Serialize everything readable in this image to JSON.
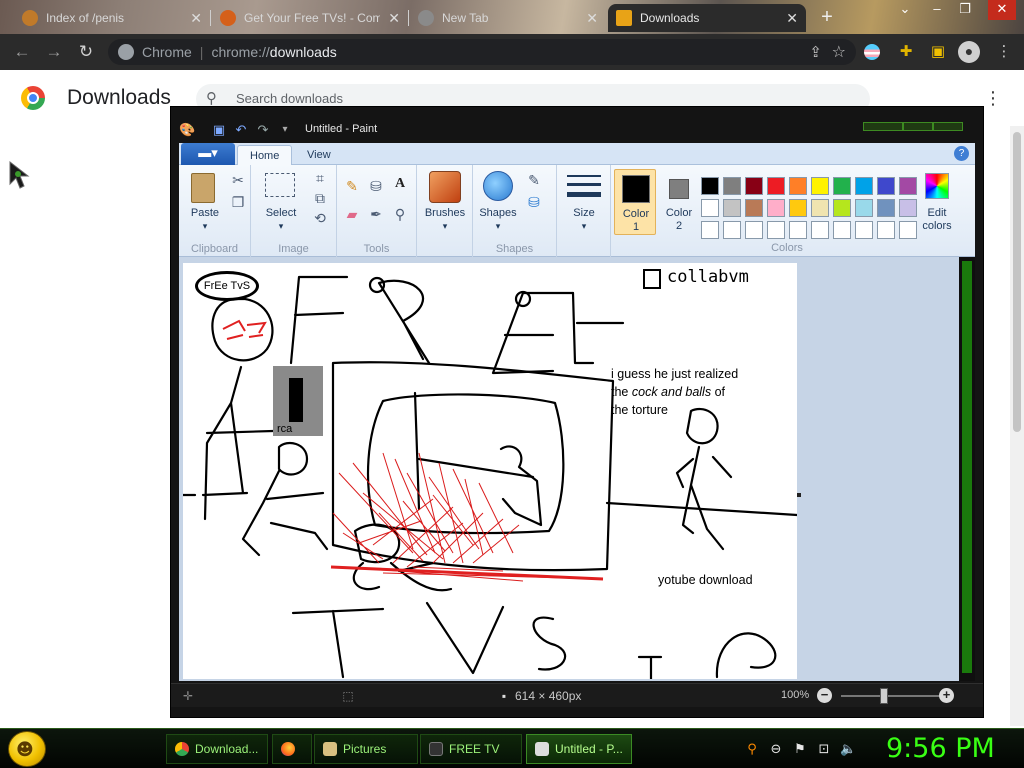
{
  "browser": {
    "tabs": [
      {
        "title": "Index of /penis"
      },
      {
        "title": "Get Your Free TVs! - Com"
      },
      {
        "title": "New Tab"
      },
      {
        "title": "Downloads"
      }
    ],
    "omnibox": {
      "site": "Chrome",
      "url_prefix": "chrome://",
      "url_path": "downloads"
    }
  },
  "downloads_page": {
    "title": "Downloads",
    "search_placeholder": "Search downloads"
  },
  "paint": {
    "window_title": "Untitled - Paint",
    "ribbon_tabs": [
      "Home",
      "View"
    ],
    "groups": {
      "clipboard": {
        "label": "Clipboard",
        "paste": "Paste"
      },
      "image": {
        "label": "Image",
        "select": "Select"
      },
      "tools": {
        "label": "Tools"
      },
      "brushes": "Brushes",
      "shapes": {
        "label": "Shapes",
        "shapes_btn": "Shapes"
      },
      "size": "Size",
      "color1": {
        "line1": "Color",
        "line2": "1"
      },
      "color2": {
        "line1": "Color",
        "line2": "2"
      },
      "colors": {
        "label": "Colors",
        "edit_line1": "Edit",
        "edit_line2": "colors"
      }
    },
    "palette": [
      "#000000",
      "#7f7f7f",
      "#880015",
      "#ed1c24",
      "#ff7f27",
      "#fff200",
      "#22b14c",
      "#00a2e8",
      "#3f48cc",
      "#a349a4",
      "#ffffff",
      "#c3c3c3",
      "#b97a57",
      "#ffaec9",
      "#ffc90e",
      "#efe4b0",
      "#b5e61d",
      "#99d9ea",
      "#7092be",
      "#c8bfe7",
      "#ffffff",
      "#ffffff",
      "#ffffff",
      "#ffffff",
      "#ffffff",
      "#ffffff",
      "#ffffff",
      "#ffffff",
      "#ffffff",
      "#ffffff"
    ],
    "canvas": {
      "bubble_text": "FrEe TvS",
      "rca_label": "rca",
      "collab_text": "collabvm",
      "caption_line1": "i guess he just realized",
      "caption_line2_pre": "the",
      "caption_line2_em": "cock and balls",
      "caption_line2_post": "of",
      "caption_line3": "the torture",
      "youtube_text": "yotube download"
    },
    "status": {
      "dimensions": "614 × 460px",
      "zoom": "100%"
    }
  },
  "taskbar": {
    "tasks": [
      {
        "label": "Download..."
      },
      {
        "label": ""
      },
      {
        "label": "Pictures"
      },
      {
        "label": "FREE TV"
      },
      {
        "label": "Untitled - P..."
      }
    ],
    "clock": "9:56 PM"
  }
}
